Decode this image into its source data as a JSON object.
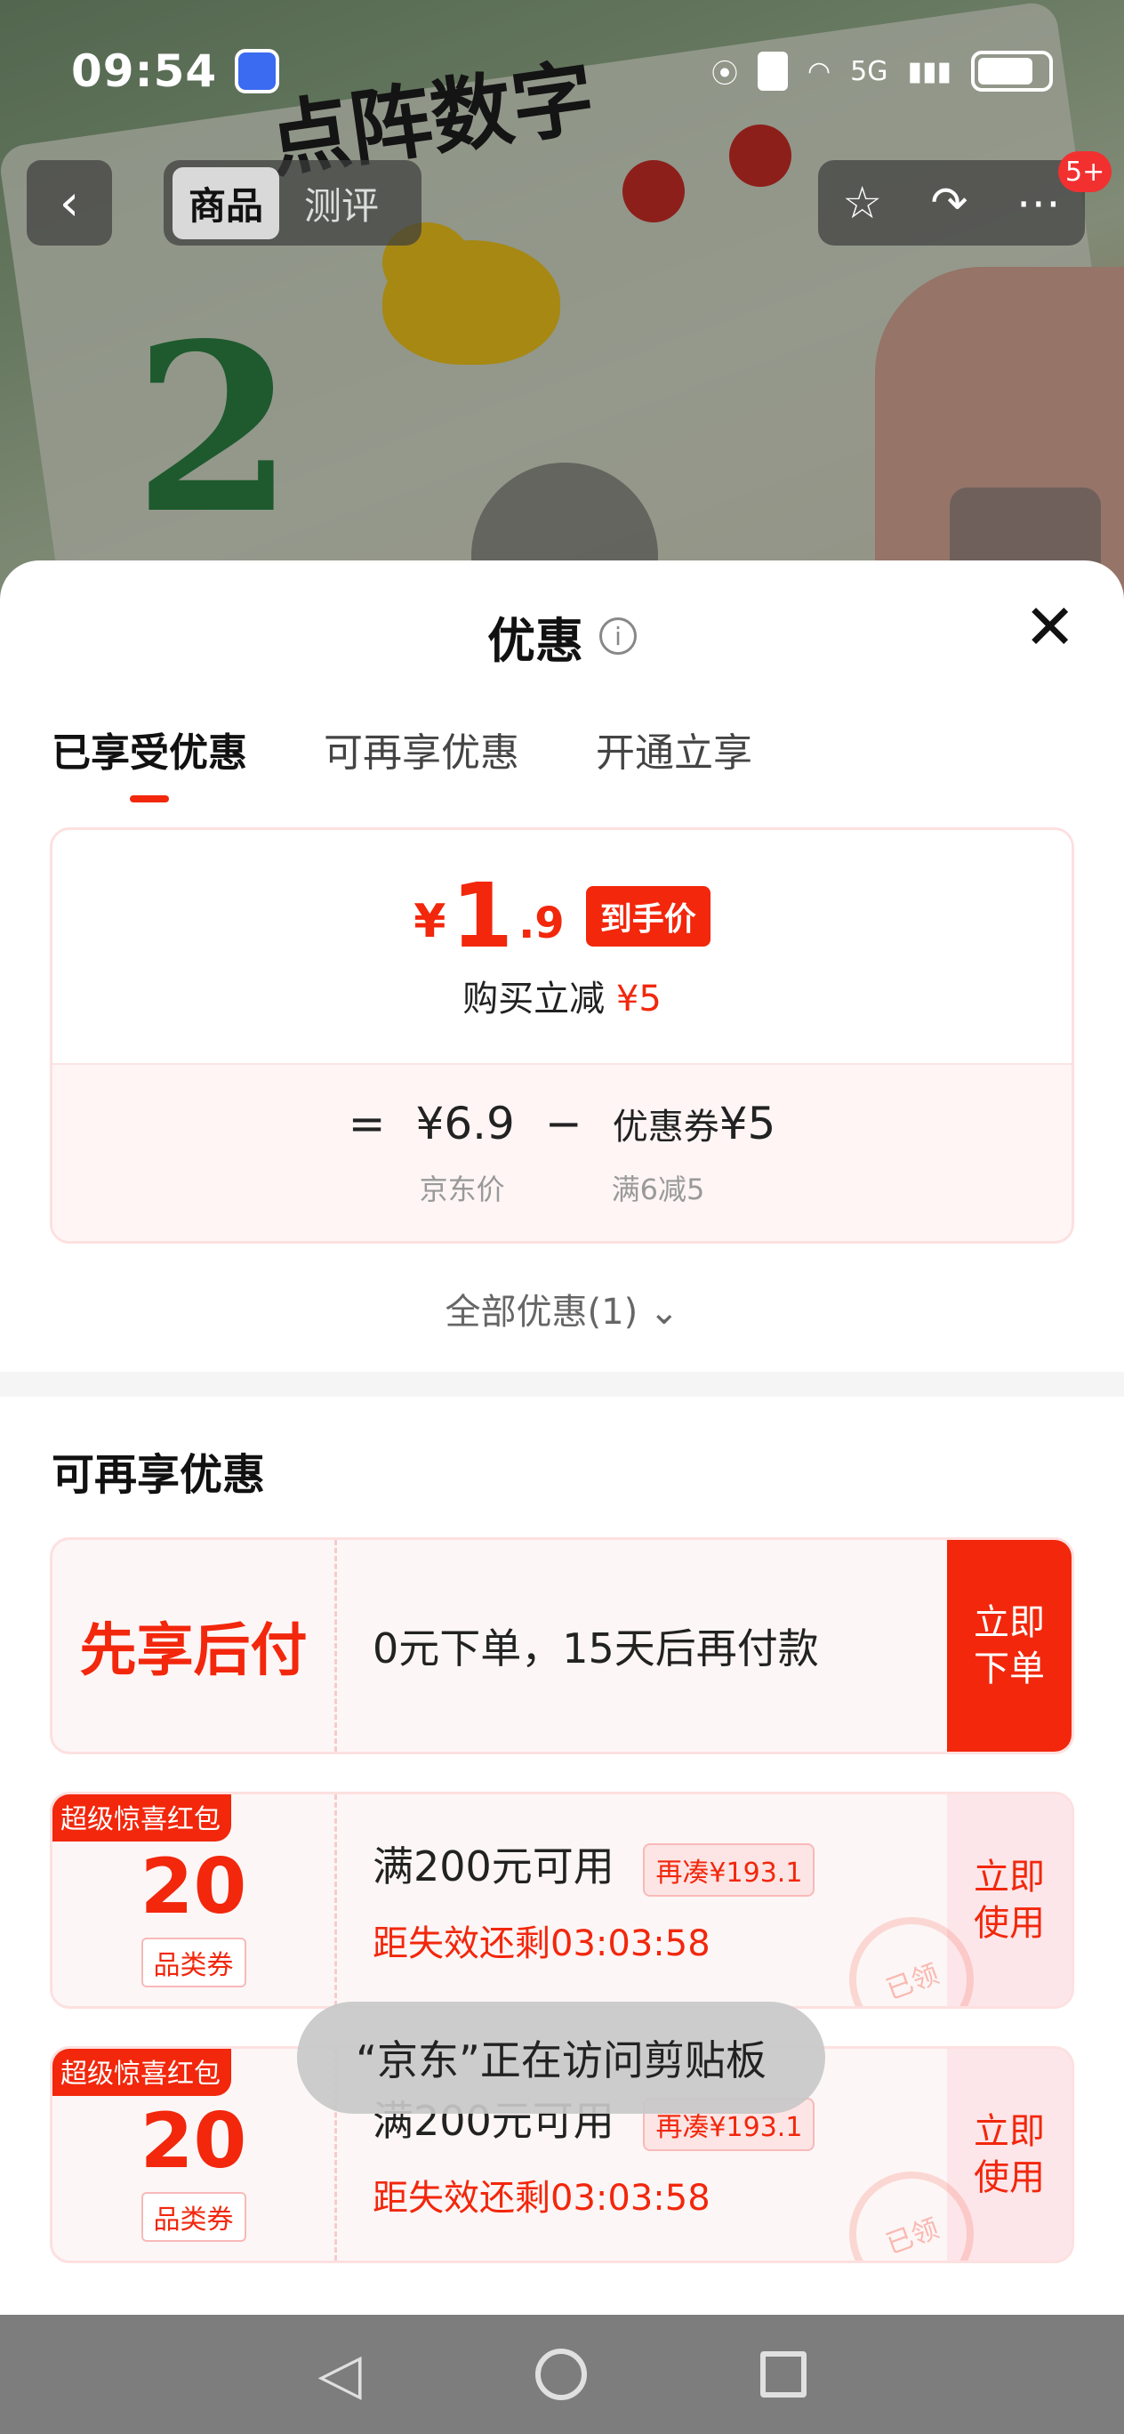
{
  "status_bar": {
    "time": "09:54",
    "network": "5G"
  },
  "nav": {
    "back_icon": "‹",
    "tabs": [
      {
        "label": "商品"
      },
      {
        "label": "测评"
      }
    ],
    "badge": "5+"
  },
  "sheet": {
    "title": "优惠",
    "close_icon": "✕",
    "tabs": [
      {
        "label": "已享受优惠"
      },
      {
        "label": "可再享优惠"
      },
      {
        "label": "开通立享"
      }
    ],
    "price": {
      "yen": "¥",
      "integer": "1",
      "decimal": ".9",
      "tag": "到手价",
      "instant_reduce_label": "购买立减",
      "instant_reduce_value": "¥5"
    },
    "formula": {
      "equals": "=",
      "jd_price": "¥6.9",
      "minus": "−",
      "coupon_label": "优惠券",
      "coupon_value": "¥5",
      "jd_price_label": "京东价",
      "coupon_rule": "满6减5"
    },
    "all_offers": "全部优惠(1)",
    "all_offers_chevron": "⌄",
    "more_section_title": "可再享优惠",
    "paylater": {
      "title": "先享后付",
      "desc": "0元下单，15天后再付款",
      "button": "立即\n下单"
    },
    "coupons": [
      {
        "ribbon": "超级惊喜红包",
        "amount": "20",
        "kind": "品类券",
        "condition": "满200元可用",
        "need_more": "再凑¥193.1",
        "countdown": "距失效还剩03:03:58",
        "button": "立即\n使用",
        "stamp": "已领"
      },
      {
        "ribbon": "超级惊喜红包",
        "amount": "20",
        "kind": "品类券",
        "condition": "满200元可用",
        "need_more": "再凑¥193.1",
        "countdown": "距失效还剩03:03:58",
        "button": "立即\n使用",
        "stamp": "已领"
      }
    ]
  },
  "toast": "“京东”正在访问剪贴板",
  "colors": {
    "accent": "#f2270c",
    "light_pink": "#fdf6f6"
  }
}
